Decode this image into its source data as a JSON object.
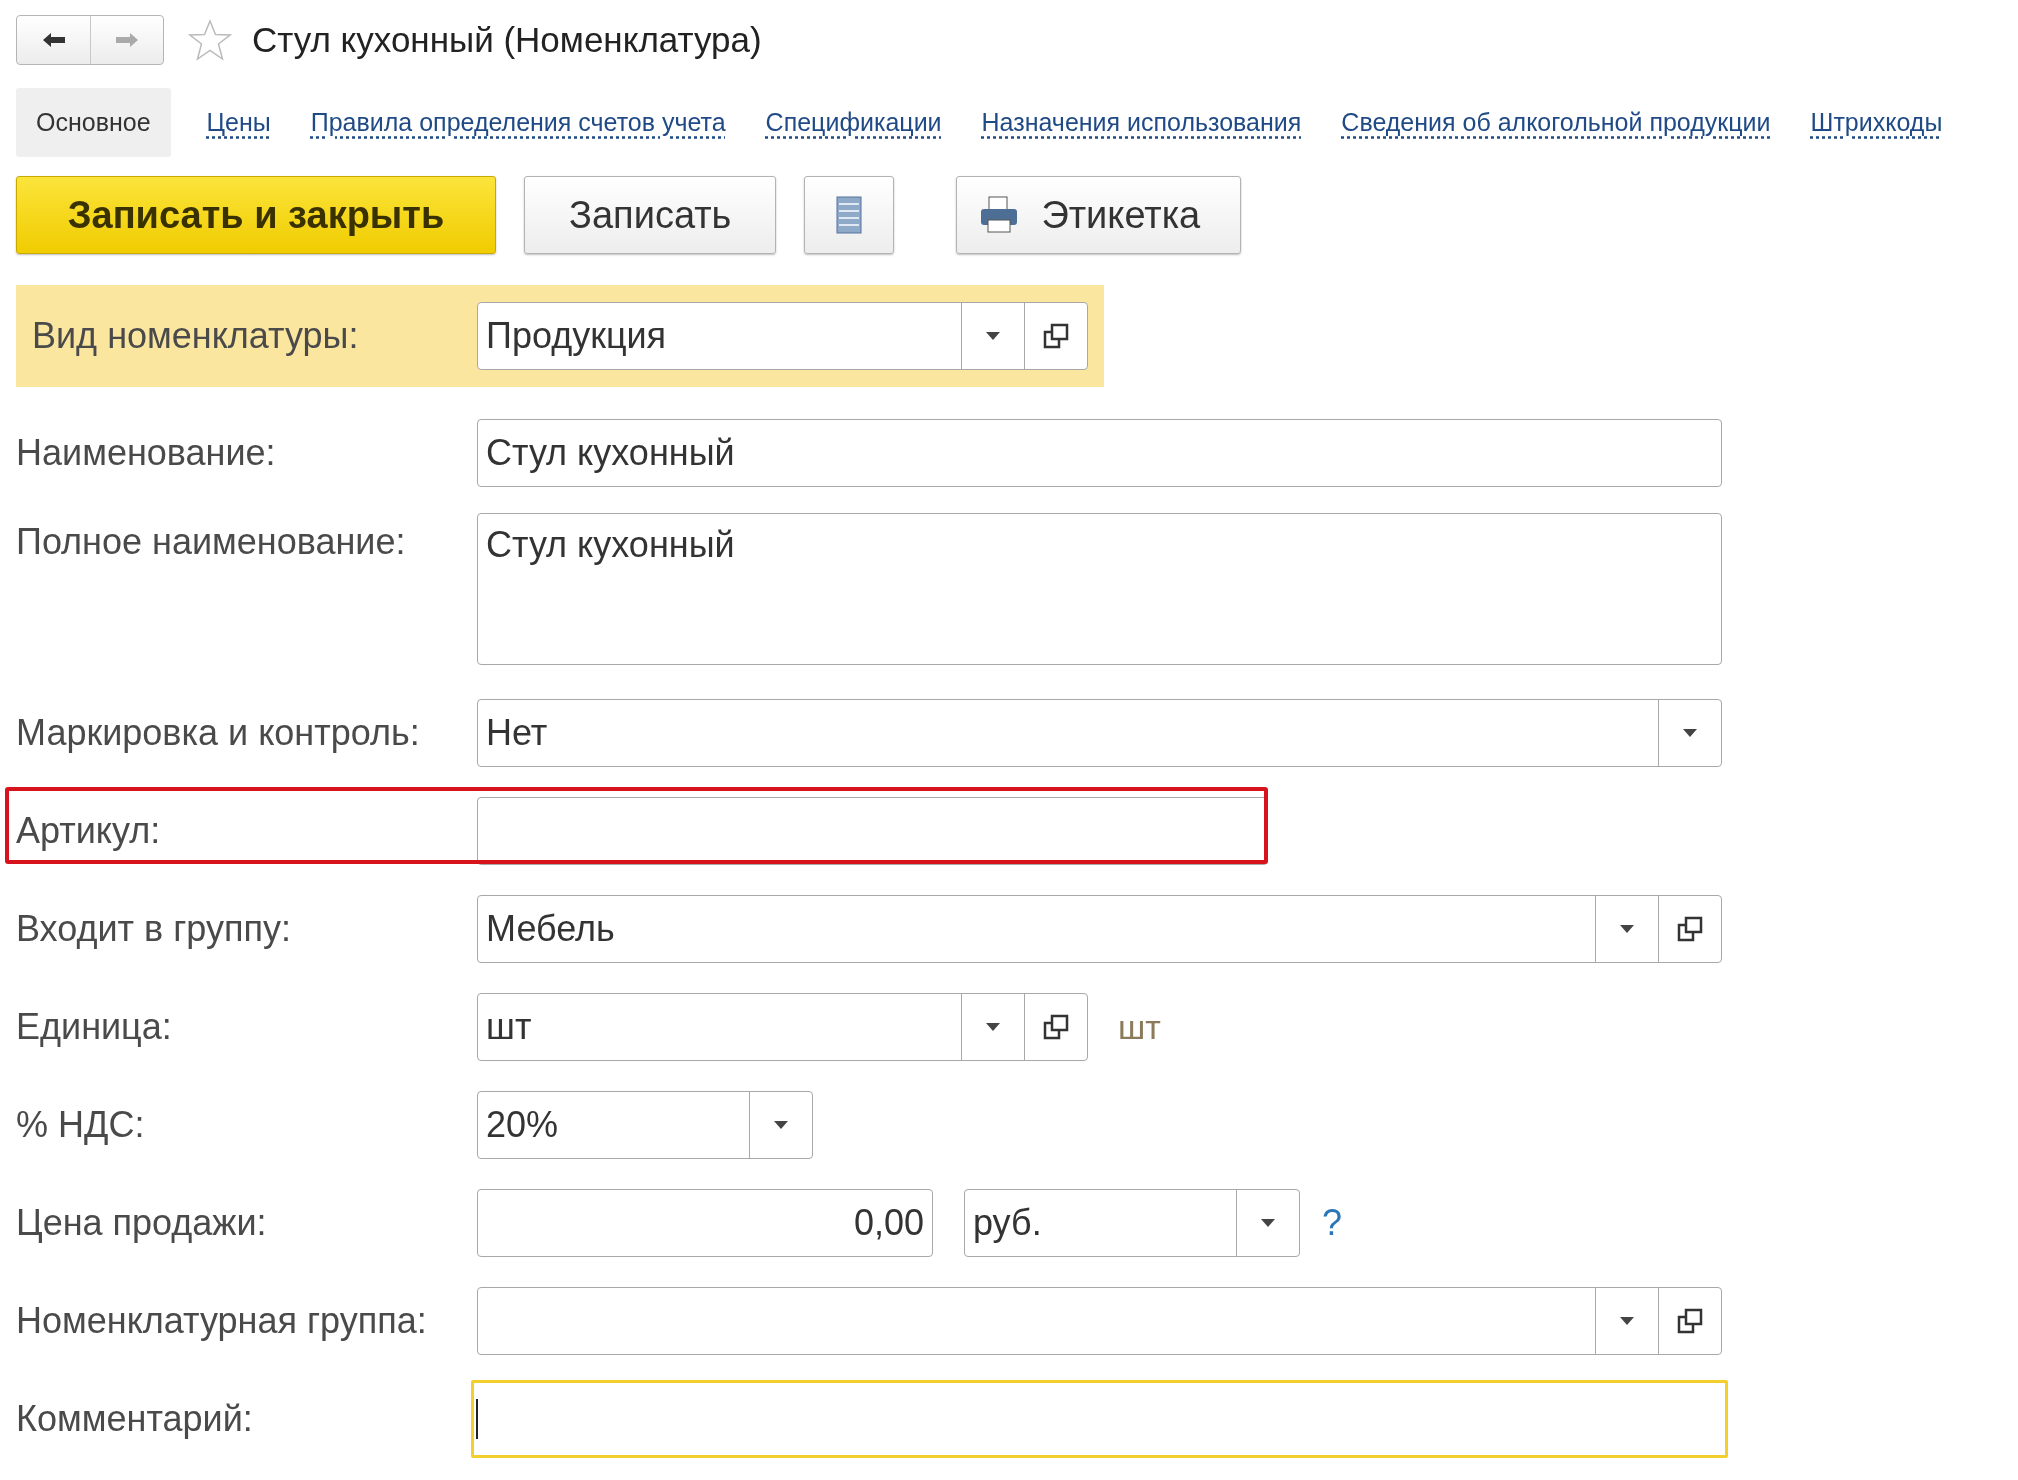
{
  "title": "Стул кухонный (Номенклатура)",
  "favorite": false,
  "tabs": [
    {
      "label": "Основное",
      "selected": true
    },
    {
      "label": "Цены",
      "selected": false
    },
    {
      "label": "Правила определения счетов учета",
      "selected": false
    },
    {
      "label": "Спецификации",
      "selected": false
    },
    {
      "label": "Назначения использования",
      "selected": false
    },
    {
      "label": "Сведения об алкогольной продукции",
      "selected": false
    },
    {
      "label": "Штрихкоды",
      "selected": false
    }
  ],
  "buttons": [
    {
      "kind": "primary",
      "label": "Записать и закрыть"
    },
    {
      "kind": "normal",
      "label": "Записать"
    },
    {
      "kind": "list"
    },
    {
      "kind": "print",
      "label": "Этикетка"
    }
  ],
  "fields": [
    {
      "kind": "short-select",
      "label": "Вид номенклатуры:",
      "value": "Продукция",
      "open_button": true,
      "emphasized": true
    },
    {
      "kind": "text",
      "label": "Наименование:",
      "value": "Стул кухонный"
    },
    {
      "kind": "textarea",
      "label": "Полное наименование:",
      "value": "Стул кухонный"
    },
    {
      "kind": "select",
      "label": "Маркировка и контроль:",
      "value": "Нет",
      "open_button": false
    },
    {
      "kind": "half-text",
      "label": "Артикул:",
      "marked": true
    },
    {
      "kind": "select",
      "label": "Входит в группу:",
      "value": "Мебель",
      "open_button": true
    },
    {
      "kind": "short-select",
      "label": "Единица:",
      "value": "шт",
      "open_button": true,
      "suffix": "шт"
    },
    {
      "kind": "narrow-select",
      "label": "% НДС:",
      "value": "20%",
      "open_button": false
    },
    {
      "kind": "price",
      "label": "Цена продажи:",
      "value": "0,00",
      "currency": "руб.",
      "help": "?"
    },
    {
      "kind": "select",
      "label": "Номенклатурная группа:",
      "open_button": true
    },
    {
      "kind": "text",
      "label": "Комментарий:",
      "focused": true
    }
  ]
}
